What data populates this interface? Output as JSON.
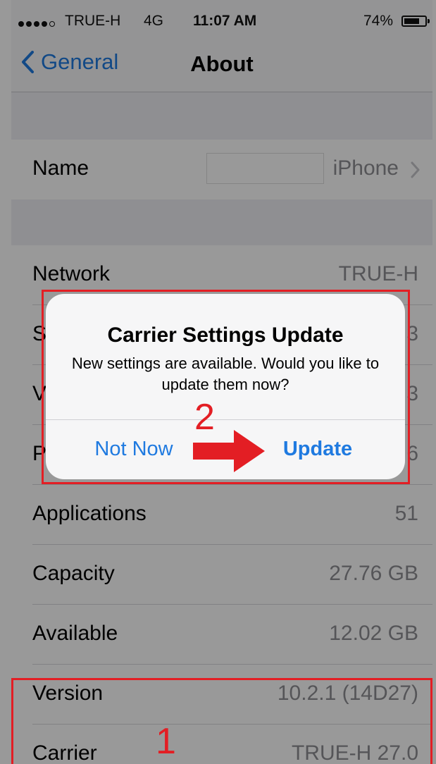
{
  "statusbar": {
    "carrier": "TRUE-H",
    "network_type": "4G",
    "time": "11:07 AM",
    "battery_percent": "74%",
    "battery_fill": 0.74,
    "signal_bars_filled": 4,
    "signal_bars_total": 5
  },
  "navbar": {
    "back_label": "General",
    "title": "About"
  },
  "rows": {
    "name": {
      "label": "Name",
      "value": "iPhone"
    },
    "network": {
      "label": "Network",
      "value": "TRUE-H"
    },
    "songs": {
      "label": "S",
      "value": "3"
    },
    "videos": {
      "label": "V",
      "value": "3"
    },
    "photos": {
      "label": "P",
      "value": "6"
    },
    "applications": {
      "label": "Applications",
      "value": "51"
    },
    "capacity": {
      "label": "Capacity",
      "value": "27.76 GB"
    },
    "available": {
      "label": "Available",
      "value": "12.02 GB"
    },
    "version": {
      "label": "Version",
      "value": "10.2.1 (14D27)"
    },
    "carrier": {
      "label": "Carrier",
      "value": "TRUE-H 27.0"
    }
  },
  "alert": {
    "title": "Carrier Settings Update",
    "message": "New settings are available.  Would you like to update them now?",
    "cancel_label": "Not Now",
    "confirm_label": "Update"
  },
  "annotations": {
    "step_one": "1",
    "step_two": "2",
    "color": "#e31e24"
  },
  "colors": {
    "ios_blue": "#1f7ae0",
    "secondary_text": "#8e8e93",
    "group_background": "#efeff4"
  }
}
